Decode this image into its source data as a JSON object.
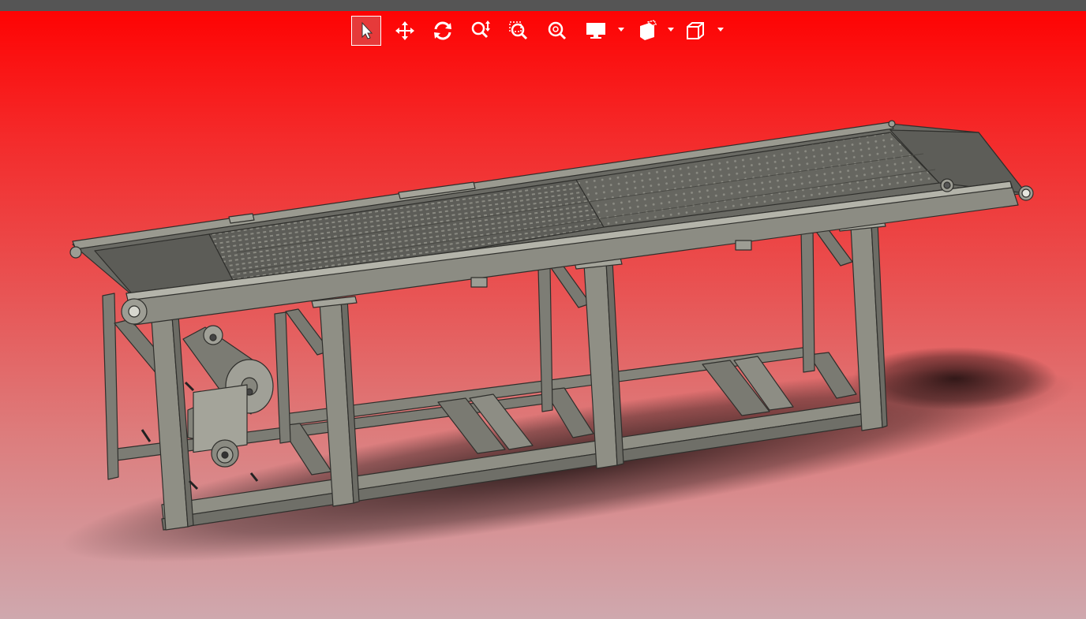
{
  "window": {
    "title_bar_color": "#555555"
  },
  "viewport": {
    "background_top": "#ff0000",
    "background_bottom": "#cfa8ae",
    "model": "conveyor-assembly",
    "model_color": "#8f8f85"
  },
  "toolbar": {
    "items": [
      {
        "icon": "select-arrow-icon",
        "active": true
      },
      {
        "icon": "pan-move-icon",
        "active": false
      },
      {
        "icon": "rotate-icon",
        "active": false
      },
      {
        "icon": "zoom-in-out-icon",
        "active": false
      },
      {
        "icon": "zoom-to-area-icon",
        "active": false
      },
      {
        "icon": "zoom-to-fit-icon",
        "active": false
      },
      {
        "icon": "display-monitor-icon",
        "active": false,
        "dropdown": true
      },
      {
        "icon": "section-view-icon",
        "active": false,
        "dropdown": true
      },
      {
        "icon": "view-orientation-cube-icon",
        "active": false,
        "dropdown": true
      }
    ]
  }
}
